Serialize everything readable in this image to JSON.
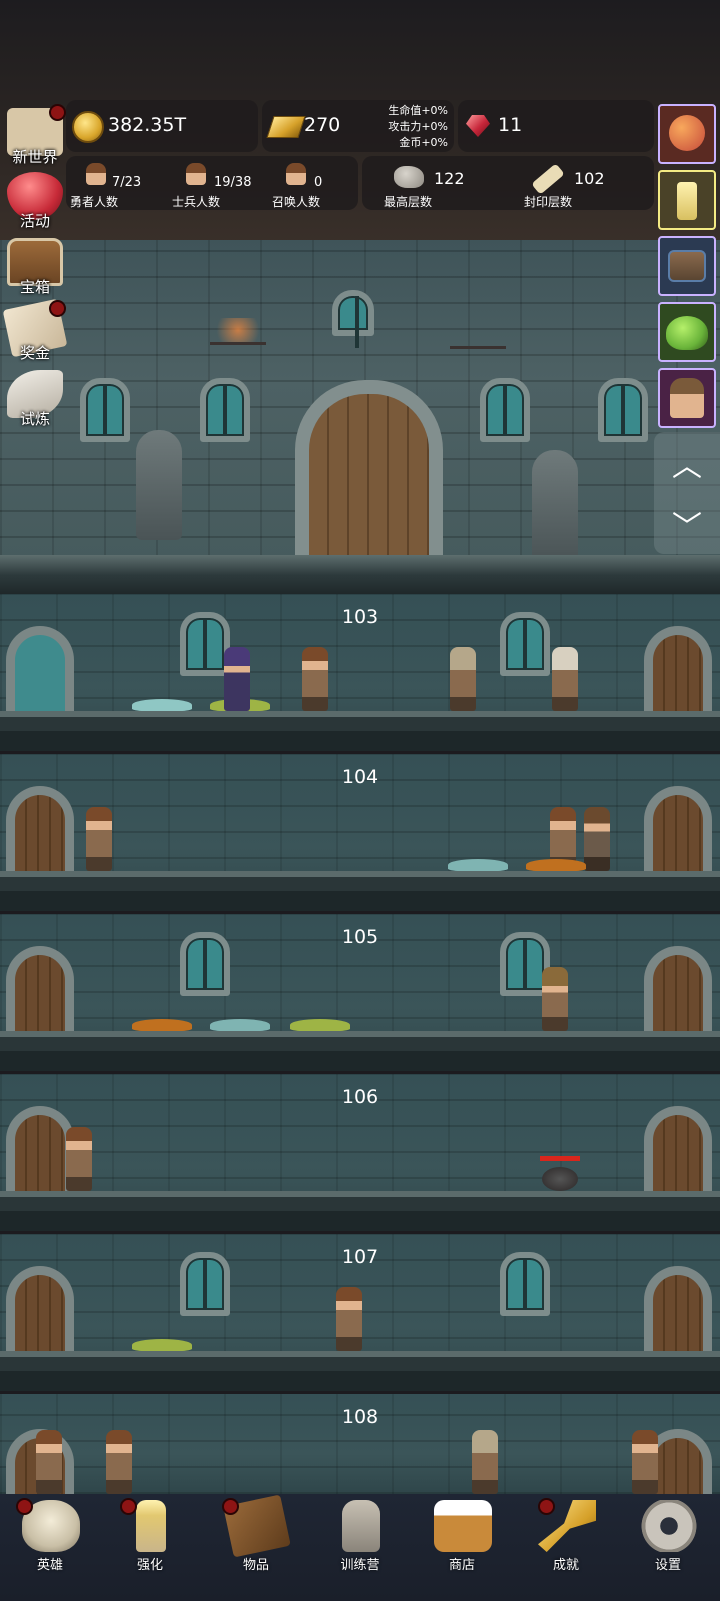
{
  "hud": {
    "coins": "382.35T",
    "gold": "270",
    "bonuses": [
      "生命值+0%",
      "攻击力+0%",
      "金币+0%"
    ],
    "gems": "11",
    "hero_count": "7/23",
    "hero_label": "勇者人数",
    "soldier_count": "19/38",
    "soldier_label": "士兵人数",
    "summon_count": "0",
    "summon_label": "召唤人数",
    "max_floor": "122",
    "max_floor_label": "最高层数",
    "sealed_floor": "102",
    "sealed_floor_label": "封印层数"
  },
  "left_menu": [
    {
      "label": "新世界",
      "icon": "map-icon",
      "badge": true
    },
    {
      "label": "活动",
      "icon": "heart-icon",
      "badge": false
    },
    {
      "label": "宝箱",
      "icon": "treasure-chest-icon",
      "badge": false
    },
    {
      "label": "奖金",
      "icon": "envelope-icon",
      "badge": true
    },
    {
      "label": "试炼",
      "icon": "feather-icon",
      "badge": false
    }
  ],
  "right_cards": [
    {
      "icon": "orange-fruit-icon",
      "color": "#c64a3a"
    },
    {
      "icon": "candle-icon",
      "color": "#d8c060"
    },
    {
      "icon": "mimic-chest-icon",
      "color": "#5a7da8"
    },
    {
      "icon": "green-slime-icon",
      "color": "#6ab43a"
    },
    {
      "icon": "hooded-hero-icon",
      "color": "#b04a9a"
    }
  ],
  "floors": [
    "103",
    "104",
    "105",
    "106",
    "107",
    "108"
  ],
  "bottom_tabs": [
    {
      "label": "英雄",
      "icon": "skull-icon",
      "badge": true
    },
    {
      "label": "强化",
      "icon": "candle-icon",
      "badge": true
    },
    {
      "label": "物品",
      "icon": "spellbook-icon",
      "badge": true
    },
    {
      "label": "训练营",
      "icon": "lantern-icon",
      "badge": false
    },
    {
      "label": "商店",
      "icon": "beer-mug-icon",
      "badge": false
    },
    {
      "label": "成就",
      "icon": "key-icon",
      "badge": true
    },
    {
      "label": "设置",
      "icon": "gear-icon",
      "badge": false
    }
  ],
  "colors": {
    "badge_red": "#8e1414",
    "hp_bar": "#d9261c"
  }
}
